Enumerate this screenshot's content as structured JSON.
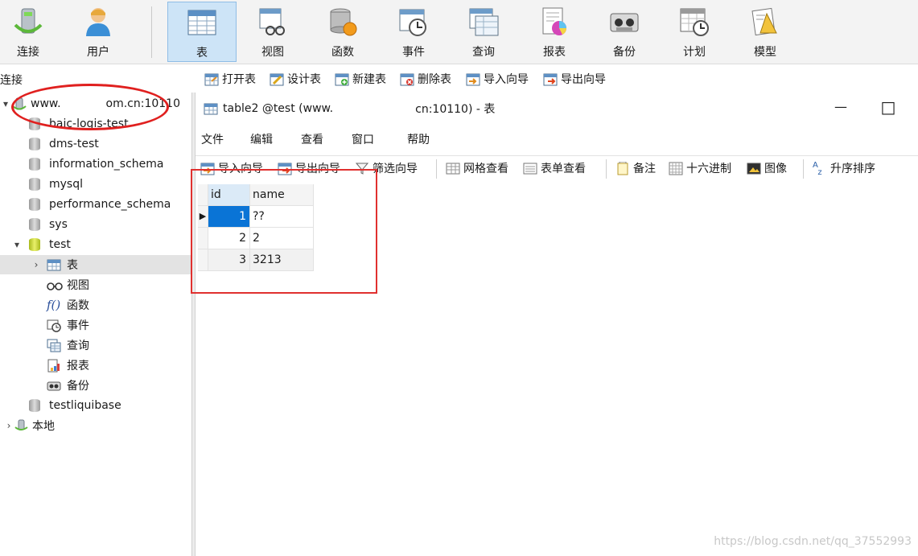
{
  "toolbar": {
    "items": [
      {
        "label": "连接",
        "icon": "connect-icon"
      },
      {
        "label": "用户",
        "icon": "user-icon"
      },
      {
        "label": "表",
        "icon": "table-icon"
      },
      {
        "label": "视图",
        "icon": "view-icon"
      },
      {
        "label": "函数",
        "icon": "function-icon"
      },
      {
        "label": "事件",
        "icon": "event-icon"
      },
      {
        "label": "查询",
        "icon": "query-icon"
      },
      {
        "label": "报表",
        "icon": "report-icon"
      },
      {
        "label": "备份",
        "icon": "backup-icon"
      },
      {
        "label": "计划",
        "icon": "schedule-icon"
      },
      {
        "label": "模型",
        "icon": "model-icon"
      }
    ],
    "active": "表"
  },
  "object_toolbar": {
    "caption": "连接",
    "buttons": [
      "打开表",
      "设计表",
      "新建表",
      "删除表",
      "导入向导",
      "导出向导"
    ]
  },
  "sidebar": {
    "connection": {
      "prefix": "www.",
      "suffix": "om.cn:10110"
    },
    "databases": [
      "baic-logis-test",
      "dms-test",
      "information_schema",
      "mysql",
      "performance_schema",
      "sys",
      "test"
    ],
    "test_children": [
      "表",
      "视图",
      "函数",
      "事件",
      "查询",
      "报表",
      "备份"
    ],
    "after": [
      "testliquibase"
    ],
    "local": "本地"
  },
  "window": {
    "title_left": "table2 @test (www.",
    "title_right": "cn:10110) - 表",
    "menu": [
      "文件",
      "编辑",
      "查看",
      "窗口",
      "帮助"
    ],
    "grid_toolbar": [
      "导入向导",
      "导出向导",
      "筛选向导",
      "网格查看",
      "表单查看",
      "备注",
      "十六进制",
      "图像",
      "升序排序"
    ]
  },
  "grid": {
    "columns": [
      "id",
      "name"
    ],
    "rows": [
      {
        "id": "1",
        "name": "??"
      },
      {
        "id": "2",
        "name": "2"
      },
      {
        "id": "3",
        "name": "3213"
      }
    ],
    "selected_row": 0
  },
  "colors": {
    "selection": "#0a74d6",
    "annotation": "#e0201f"
  },
  "watermark": "https://blog.csdn.net/qq_37552993"
}
